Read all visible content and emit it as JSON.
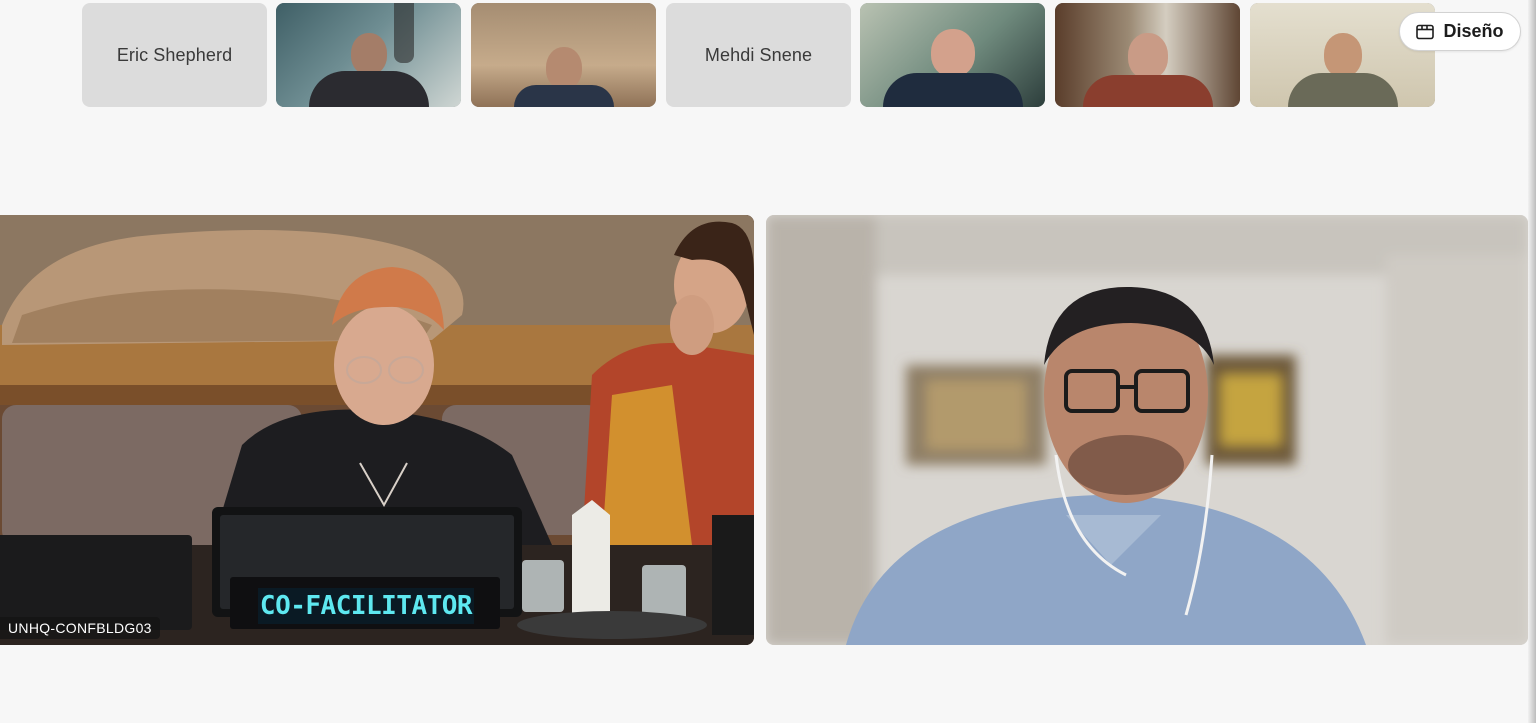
{
  "layout_button": {
    "label": "Diseño",
    "icon": "layout-icon"
  },
  "participants": [
    {
      "name": "Eric Shepherd",
      "video": false
    },
    {
      "name": "",
      "video": true
    },
    {
      "name": "",
      "video": true
    },
    {
      "name": "Mehdi Snene",
      "video": false
    },
    {
      "name": "",
      "video": true
    },
    {
      "name": "",
      "video": true
    },
    {
      "name": "",
      "video": true
    }
  ],
  "main": {
    "left_tile": {
      "name_tag": "UNHQ-CONFBLDG03",
      "placard": "CO-FACILITATOR"
    },
    "right_tile": {
      "name_tag": ""
    }
  },
  "colors": {
    "page_bg": "#f7f7f7",
    "name_only_tile": "#dcdcdc",
    "placard_text": "#5ee8f0"
  }
}
